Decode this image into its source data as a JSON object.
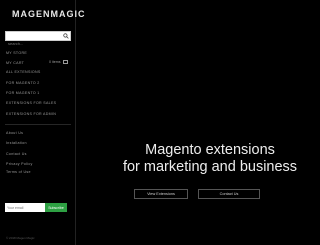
{
  "brand": {
    "logo_text": "MAGENMAGIC"
  },
  "search": {
    "placeholder": "search..."
  },
  "nav": {
    "items": [
      {
        "label": "MY STORE"
      },
      {
        "label": "MY CART",
        "extra": "0 items"
      },
      {
        "label": "ALL EXTENSIONS"
      },
      {
        "label": "FOR MAGENTO 2"
      },
      {
        "label": "FOR MAGENTO 1"
      },
      {
        "label": "EXTENSIONS FOR SALES"
      },
      {
        "label": "EXTENSIONS FOR ADMIN"
      }
    ],
    "secondary": [
      {
        "label": "About Us"
      },
      {
        "label": "Installation"
      },
      {
        "label": "Contact Us"
      },
      {
        "label": "Privacy Policy"
      },
      {
        "label": "Terms of Use"
      }
    ]
  },
  "newsletter": {
    "placeholder": "Your email",
    "button_label": "Subscribe"
  },
  "footer": {
    "copyright": "© 2018 Magen Magic"
  },
  "hero": {
    "title_line1": "Magento extensions",
    "title_line2": "for marketing and business",
    "primary_button": "View Extensions",
    "secondary_button": "Contact Us"
  },
  "colors": {
    "background": "#000000",
    "accent": "#2ea043"
  }
}
